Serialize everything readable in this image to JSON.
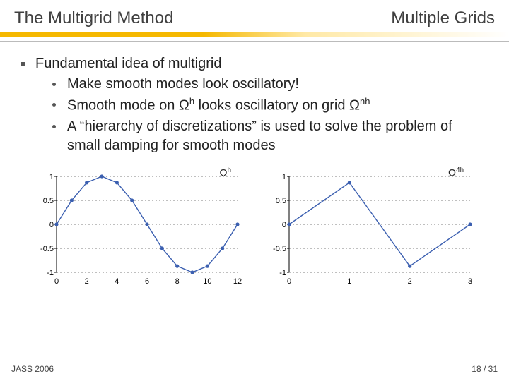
{
  "header": {
    "left": "The Multigrid Method",
    "right": "Multiple Grids"
  },
  "main_bullet": "Fundamental idea of multigrid",
  "sub_bullets": [
    "Make smooth modes look oscillatory!",
    "Smooth mode on Ωh looks oscillatory on grid Ωnh",
    "A \"hierarchy of discretizations\" is used to solve the problem of small damping for smooth modes"
  ],
  "sub_bullets_html": [
    "Make smooth modes look oscillatory!",
    "Smooth mode on Ω<sup>h</sup> looks oscillatory on grid Ω<sup>nh</sup>",
    "A “hierarchy of discretizations” is used to solve the problem of small damping for smooth modes"
  ],
  "chart_data": [
    {
      "type": "line",
      "title": "",
      "label": "Ωh",
      "label_html": "Ω<sup>h</sup>",
      "x": [
        0,
        1,
        2,
        3,
        4,
        5,
        6,
        7,
        8,
        9,
        10,
        11,
        12
      ],
      "y": [
        0,
        0.5,
        0.87,
        1,
        0.87,
        0.5,
        0,
        -0.5,
        -0.87,
        -1,
        -0.87,
        -0.5,
        0
      ],
      "xlim": [
        0,
        12
      ],
      "ylim": [
        -1,
        1
      ],
      "xticks": [
        0,
        2,
        4,
        6,
        8,
        10,
        12
      ],
      "yticks": [
        -1,
        -0.5,
        0,
        0.5,
        1
      ],
      "ytick_labels": [
        "-1",
        "-0.5",
        "0",
        "0.5",
        "1"
      ]
    },
    {
      "type": "line",
      "title": "",
      "label": "Ω4h",
      "label_html": "Ω<sup>4h</sup>",
      "x": [
        0,
        1,
        2,
        3
      ],
      "y": [
        0,
        0.87,
        -0.87,
        0
      ],
      "xlim": [
        0,
        3
      ],
      "ylim": [
        -1,
        1
      ],
      "xticks": [
        0,
        1,
        2,
        3
      ],
      "yticks": [
        -1,
        -0.5,
        0,
        0.5,
        1
      ],
      "ytick_labels": [
        "-1",
        "-0.5",
        "0",
        "0.5",
        "1"
      ]
    }
  ],
  "footer": {
    "left": "JASS 2006",
    "right": "18 / 31"
  }
}
